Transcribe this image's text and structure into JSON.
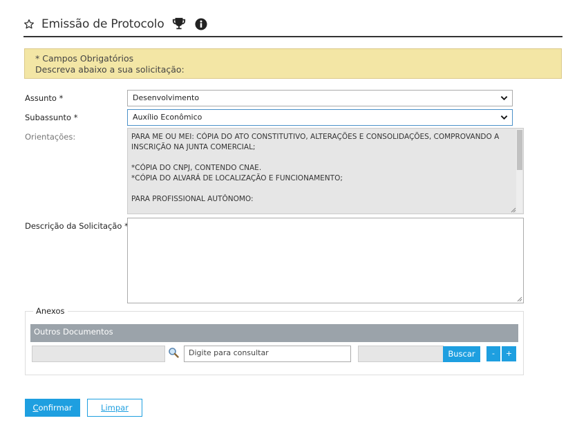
{
  "header": {
    "title": "Emissão de Protocolo",
    "icons": [
      "star-outline-icon",
      "trophy-icon",
      "info-icon"
    ]
  },
  "alert": {
    "required_note": "* Campos Obrigatórios",
    "instruction": "Descreva abaixo a sua solicitação:"
  },
  "form": {
    "assunto": {
      "label": "Assunto *",
      "value": "Desenvolvimento"
    },
    "subassunto": {
      "label": "Subassunto *",
      "value": "Auxílio Econômico"
    },
    "orientacoes": {
      "label": "Orientações:",
      "text": "PARA ME OU MEI: CÓPIA DO ATO CONSTITUTIVO, ALTERAÇÕES E CONSOLIDAÇÕES, COMPROVANDO A\nINSCRIÇÃO NA JUNTA COMERCIAL;\n\n*CÓPIA DO CNPJ, CONTENDO CNAE.\n*CÓPIA DO ALVARÁ DE LOCALIZAÇÃO E FUNCIONAMENTO;\n\nPARA PROFISSIONAL AUTÔNOMO:"
    },
    "descricao": {
      "label": "Descrição da Solicitação *",
      "value": ""
    }
  },
  "anexos": {
    "legend": "Anexos",
    "section_title": "Outros Documentos",
    "search_placeholder": "Digite para consultar",
    "search_button": "Buscar",
    "remove_button": "-",
    "add_button": "+"
  },
  "actions": {
    "confirm_first": "C",
    "confirm_rest": "onfirmar",
    "clear_first": "L",
    "clear_rest": "impar"
  },
  "colors": {
    "accent": "#1e9fe0",
    "alert_bg": "#f3e6a5",
    "section_header": "#9ba3aa"
  }
}
